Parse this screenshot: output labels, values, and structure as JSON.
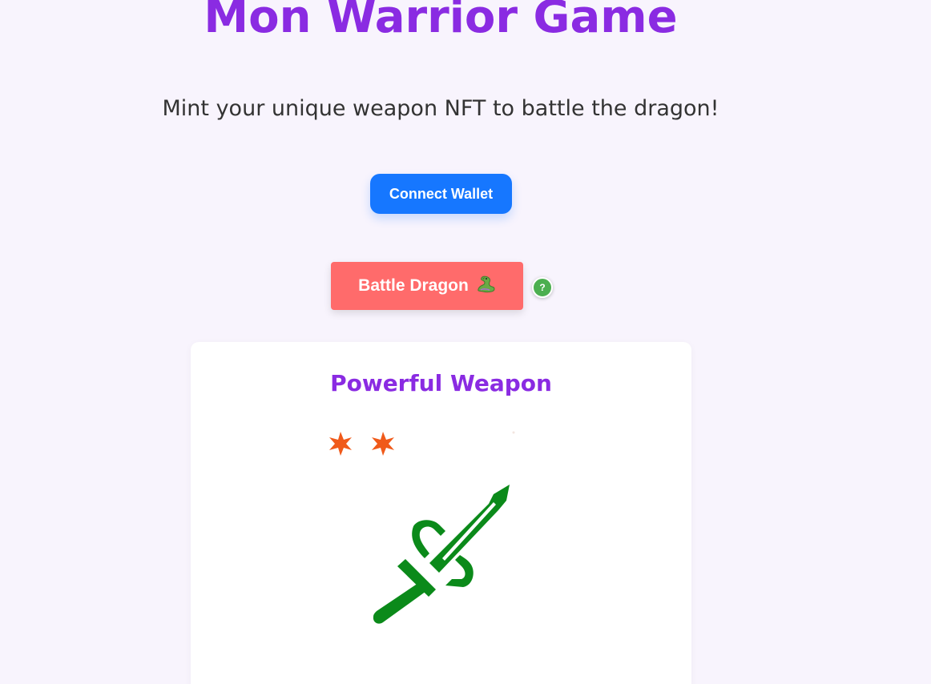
{
  "header": {
    "title": "Mon Warrior Game",
    "subtitle": "Mint your unique weapon NFT to battle the dragon!"
  },
  "actions": {
    "connect_label": "Connect Wallet",
    "battle_label": "Battle Dragon",
    "battle_icon": "dragon-icon",
    "help_label": "?"
  },
  "weapon_card": {
    "title": "Powerful Weapon",
    "icon": "sword-icon",
    "effects": "spark-icons"
  },
  "colors": {
    "accent_purple": "#8a2be2",
    "connect_blue": "#1677ff",
    "battle_red": "#ff6b6b",
    "help_green": "#4caf50",
    "sword_green": "#0b8a1a",
    "spark_orange": "#f05a1a",
    "background": "#f8f4fd"
  }
}
